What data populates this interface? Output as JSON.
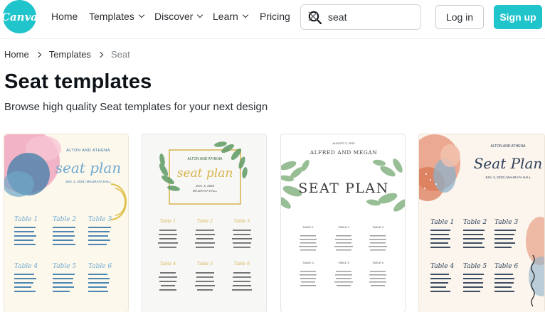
{
  "logo": {
    "text": "Canva"
  },
  "nav": {
    "home": "Home",
    "templates": "Templates",
    "discover": "Discover",
    "learn": "Learn",
    "pricing": "Pricing"
  },
  "search": {
    "value": "seat"
  },
  "auth": {
    "login": "Log in",
    "signup": "Sign up"
  },
  "breadcrumb": {
    "home": "Home",
    "templates": "Templates",
    "current": "Seat"
  },
  "page": {
    "title": "Seat templates",
    "subtitle": "Browse high quality Seat templates for your next design"
  },
  "colors": {
    "brand": "#20c4cb",
    "text": "#0e1318",
    "muted": "#80868b"
  },
  "cards": [
    {
      "names": "ALTON AND ATHENA",
      "heading": "seat plan",
      "date": "JUN. 3, 2020 | MALIRAYA HALL",
      "tables": [
        "Table 1",
        "Table 2",
        "Table 3",
        "Table 4",
        "Table 5",
        "Table 6"
      ]
    },
    {
      "names": "ALTON AND ATHENA",
      "heading": "seat plan",
      "date": "JUN. 3, 2020",
      "venue": "MALIRAYA HALL",
      "tables": [
        "Table 1",
        "Table 2",
        "Table 3",
        "Table 4",
        "Table 5",
        "Table 6"
      ]
    },
    {
      "date": "AUGUST 3, 2020",
      "names": "ALFRED AND MEGAN",
      "heading": "SEAT PLAN",
      "tables": [
        "TABLE 1",
        "TABLE 2",
        "TABLE 3",
        "TABLE 4",
        "TABLE 5",
        "TABLE 6"
      ]
    },
    {
      "names": "ALTON AND ATHENA",
      "heading": "Seat Plan",
      "date": "JUN. 3, 2020 | MALIRAYA HALL",
      "tables": [
        "Table 1",
        "Table 2",
        "Table 3",
        "Table 4",
        "Table 5",
        "Table 6"
      ]
    }
  ]
}
